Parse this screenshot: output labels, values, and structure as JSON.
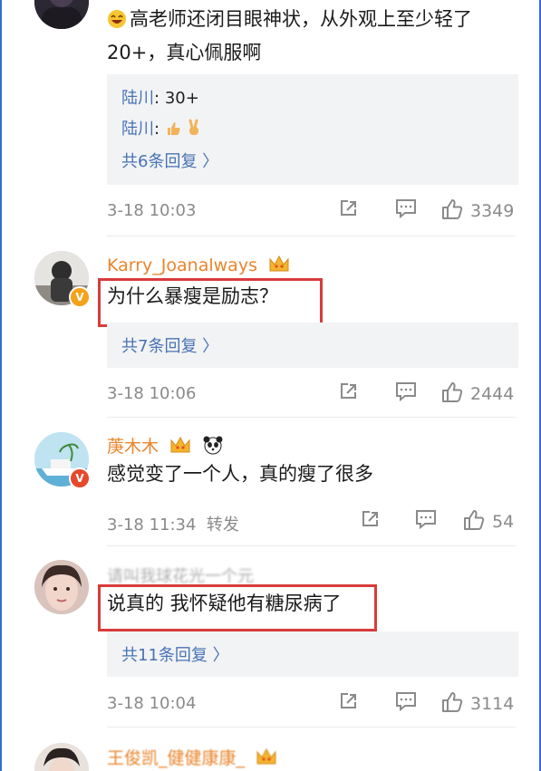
{
  "comments": [
    {
      "text": "高老师还闭目眼神状，从外观上至少轻了20+，真心佩服啊",
      "replies": [
        {
          "user": "陆川",
          "sep": ":",
          "content": "30+"
        },
        {
          "user": "陆川",
          "sep": ":",
          "content": ""
        }
      ],
      "more": "共6条回复 〉",
      "time": "3-18 10:03",
      "likes": "3349"
    },
    {
      "user": "Karry_Joanalways",
      "text": "为什么暴瘦是励志？",
      "more": "共7条回复 〉",
      "time": "3-18 10:06",
      "likes": "2444"
    },
    {
      "user": "菮木木",
      "text": "感觉变了一个人，真的瘦了很多",
      "time": "3-18 11:34",
      "repost": "转发",
      "likes": "54"
    },
    {
      "user": "请叫我球花光一个元",
      "text": "说真的 我怀疑他有糖尿病了",
      "more": "共11条回复 〉",
      "time": "3-18 10:04",
      "likes": "3114"
    },
    {
      "user": "王俊凯_健健康康_"
    }
  ],
  "colors": {
    "username": "#e9852c",
    "link": "#4873b4",
    "highlight": "#d93b3b",
    "meta": "#8a8a8a"
  },
  "icons": [
    "share-icon",
    "comment-icon",
    "like-icon",
    "crown-icon",
    "panda-icon",
    "verified-badge"
  ]
}
